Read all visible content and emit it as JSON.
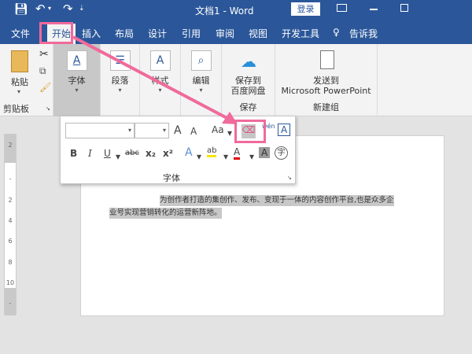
{
  "titlebar": {
    "title": "文档1  -  Word",
    "login": "登录",
    "undo_caret": "▾",
    "qa_more": "⇣"
  },
  "tabs": [
    "文件",
    "开始",
    "插入",
    "布局",
    "设计",
    "引用",
    "审阅",
    "视图",
    "开发工具"
  ],
  "tell_me": "告诉我",
  "ribbon": {
    "clipboard": {
      "paste": "粘贴",
      "label": "剪贴板"
    },
    "font": {
      "label": "字体"
    },
    "paragraph": {
      "label": "段落"
    },
    "styles": {
      "label": "样式"
    },
    "editing": {
      "label": "编辑"
    },
    "save": {
      "button": "保存到",
      "button2": "百度网盘",
      "label": "保存"
    },
    "newgroup": {
      "button": "发送到",
      "button2": "Microsoft PowerPoint",
      "label": "新建组"
    }
  },
  "font_popup": {
    "label": "字体",
    "change_case": "Aa",
    "bold": "B",
    "italic": "I",
    "underline": "U",
    "strike": "abc",
    "sub": "x₂",
    "sup": "x²",
    "phonetic": "wén",
    "char_border": "A",
    "char_shading": "A",
    "enclose": "字",
    "grow": "A",
    "shrink": "A",
    "font_color": "A",
    "text_effect": "A",
    "highlight": "ab"
  },
  "ruler": [
    "2",
    "",
    "",
    "2",
    "4",
    "6",
    "8",
    "10",
    ""
  ],
  "document": {
    "line1": "为创作者打造的集创作、发布、变现于一体的内容创作平台,也是众多企",
    "line2": "业号实现营销转化的运营新阵地。"
  },
  "colors": {
    "accent": "#2b579a",
    "highlight": "#f06a9b"
  }
}
